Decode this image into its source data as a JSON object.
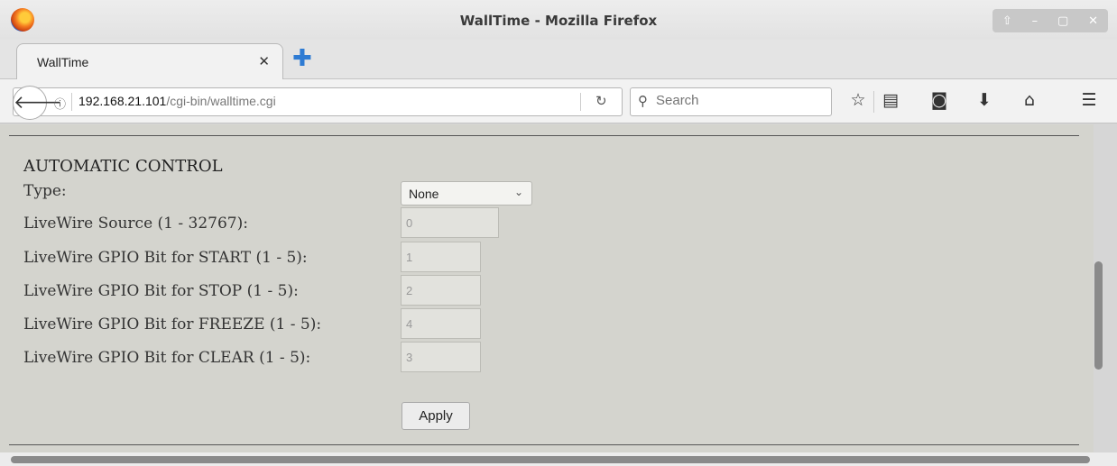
{
  "window": {
    "title": "WallTime - Mozilla Firefox",
    "controls": [
      "⇧",
      "–",
      "▢",
      "✕"
    ]
  },
  "tab": {
    "label": "WallTime",
    "close": "✕",
    "new_tab": "✚"
  },
  "nav": {
    "info": "ⓘ",
    "url_host": "192.168.21.101",
    "url_path": "/cgi-bin/walltime.cgi",
    "reload": "↻",
    "search_placeholder": "Search",
    "search_glyph": "🔍",
    "icons": {
      "bookmark": "☆",
      "reader": "▤",
      "pocket": "◙",
      "download": "⬇",
      "home": "⌂",
      "menu": "☰"
    }
  },
  "section": {
    "title": "AUTOMATIC CONTROL",
    "type_label": "Type:",
    "type_value": "None",
    "source_label": "LiveWire Source (1 - 32767):",
    "source_value": "0",
    "start_label": "LiveWire GPIO Bit for START (1 - 5):",
    "start_value": "1",
    "stop_label": "LiveWire GPIO Bit for STOP (1 - 5):",
    "stop_value": "2",
    "freeze_label": "LiveWire GPIO Bit for FREEZE (1 - 5):",
    "freeze_value": "4",
    "clear_label": "LiveWire GPIO Bit for CLEAR (1 - 5):",
    "clear_value": "3",
    "apply_label": "Apply"
  }
}
